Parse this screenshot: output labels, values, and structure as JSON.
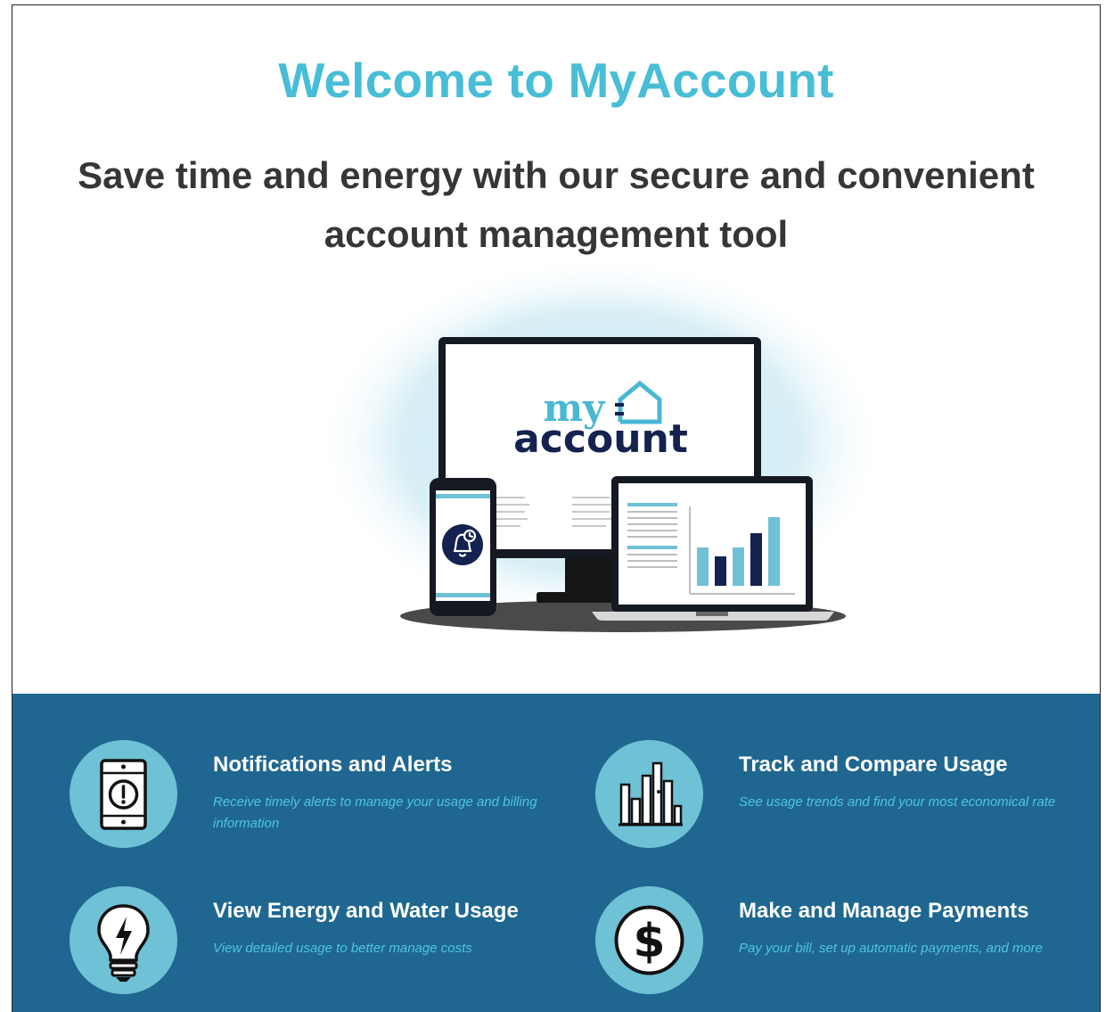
{
  "hero": {
    "title": "Welcome to MyAccount",
    "subtitle": "Save time and energy with our secure and convenient account management tool"
  },
  "illustration": {
    "logo_line1": "my",
    "logo_line2": "account"
  },
  "features": [
    {
      "title": "Notifications and Alerts",
      "description": "Receive timely alerts to manage your usage and billing information",
      "icon": "phone-alert-icon"
    },
    {
      "title": "Track and Compare Usage",
      "description": "See usage trends and find your most economical rate",
      "icon": "bar-chart-icon"
    },
    {
      "title": "View Energy and Water Usage",
      "description": "View detailed usage to better manage costs",
      "icon": "lightbulb-icon"
    },
    {
      "title": "Make and Manage Payments",
      "description": "Pay your bill, set up automatic payments, and more",
      "icon": "dollar-icon"
    }
  ],
  "colors": {
    "title_accent": "#48bdd6",
    "subtitle_text": "#363636",
    "features_background": "#1f6790",
    "icon_circle": "#6fc1d6",
    "feature_description": "#4fc5df",
    "logo_navy": "#14224f"
  }
}
